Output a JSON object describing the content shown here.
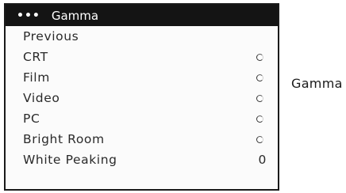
{
  "menu": {
    "header": {
      "dots": "•••",
      "title": "Gamma"
    },
    "items": [
      {
        "label": "Previous",
        "control": "none"
      },
      {
        "label": "CRT",
        "control": "radio"
      },
      {
        "label": "Film",
        "control": "radio"
      },
      {
        "label": "Video",
        "control": "radio"
      },
      {
        "label": "PC",
        "control": "radio"
      },
      {
        "label": "Bright Room",
        "control": "radio"
      },
      {
        "label": "White Peaking",
        "control": "value",
        "value": "0"
      }
    ]
  },
  "side_label": "Gamma"
}
